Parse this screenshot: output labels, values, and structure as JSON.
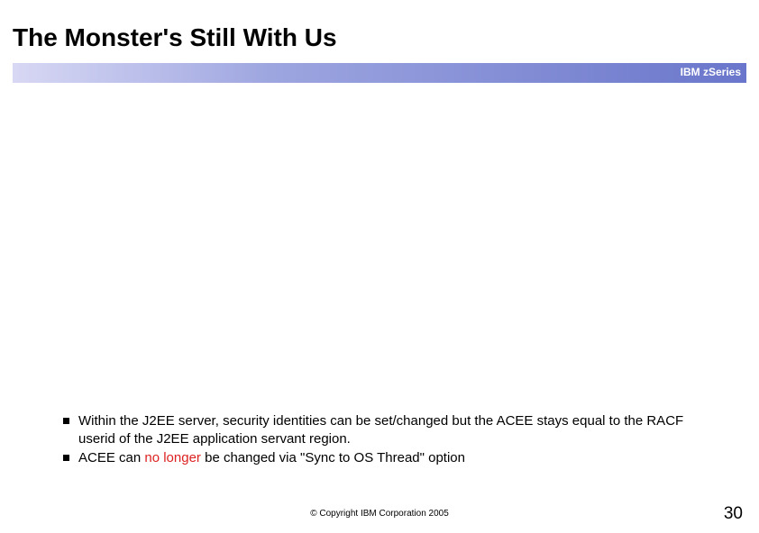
{
  "title": "The Monster's Still With Us",
  "bar_label": "IBM zSeries",
  "bullets": [
    {
      "pre": "Within the J2EE server, security identities can be set/changed but the ACEE stays equal to the RACF userid of the J2EE application servant region.",
      "red": "",
      "post": ""
    },
    {
      "pre": "ACEE can ",
      "red": "no longer",
      "post": " be changed via \"Sync to OS Thread\" option"
    }
  ],
  "copyright": "© Copyright IBM Corporation 2005",
  "page_number": "30"
}
